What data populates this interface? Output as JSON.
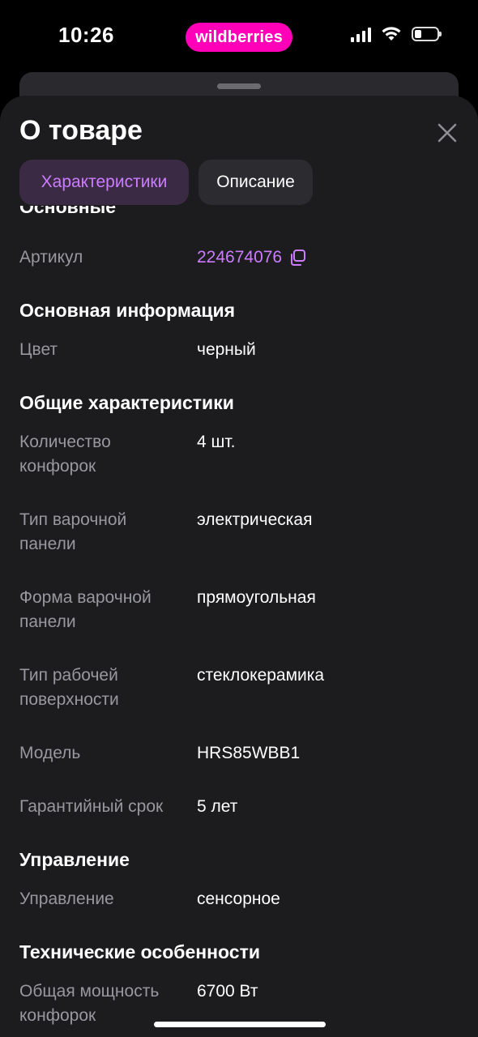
{
  "status_bar": {
    "time": "10:26",
    "brand": "wildberries"
  },
  "sheet": {
    "title": "О товаре",
    "tabs": [
      {
        "label": "Характеристики",
        "active": true
      },
      {
        "label": "Описание",
        "active": false
      }
    ]
  },
  "sections": {
    "basic": {
      "title": "Основные",
      "article_label": "Артикул",
      "article_value": "224674076"
    },
    "main_info": {
      "title": "Основная информация",
      "color_label": "Цвет",
      "color_value": "черный"
    },
    "general": {
      "title": "Общие характеристики",
      "burners_label": "Количество конфорок",
      "burners_value": "4 шт.",
      "panel_type_label": "Тип варочной панели",
      "panel_type_value": "электрическая",
      "panel_shape_label": "Форма варочной панели",
      "panel_shape_value": "прямоугольная",
      "surface_label": "Тип рабочей поверхности",
      "surface_value": "стеклокерамика",
      "model_label": "Модель",
      "model_value": "HRS85WBB1",
      "warranty_label": "Гарантийный срок",
      "warranty_value": "5 лет"
    },
    "control": {
      "title": "Управление",
      "control_label": "Управление",
      "control_value": "сенсорное"
    },
    "tech": {
      "title": "Технические особенности",
      "power_label": "Общая мощность конфорок",
      "power_value": "6700 Вт"
    }
  },
  "colors": {
    "accent": "#cc7cff",
    "brand": "#ff00b8",
    "sheet_bg": "#1c1c1e"
  }
}
